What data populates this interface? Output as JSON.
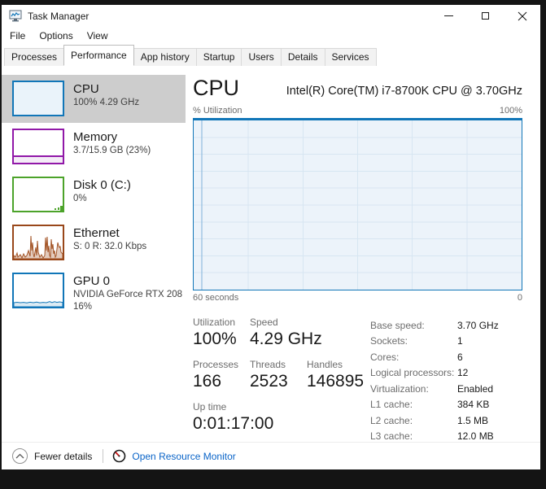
{
  "window": {
    "title": "Task Manager"
  },
  "menu": {
    "items": [
      "File",
      "Options",
      "View"
    ]
  },
  "tabs": {
    "items": [
      "Processes",
      "Performance",
      "App history",
      "Startup",
      "Users",
      "Details",
      "Services"
    ],
    "active": "Performance"
  },
  "sidebar": {
    "items": [
      {
        "label": "CPU",
        "line2": "100% 4.29 GHz"
      },
      {
        "label": "Memory",
        "line2": "3.7/15.9 GB (23%)"
      },
      {
        "label": "Disk 0 (C:)",
        "line2": "0%"
      },
      {
        "label": "Ethernet",
        "line2": "S: 0 R: 32.0 Kbps"
      },
      {
        "label": "GPU 0",
        "line2": "NVIDIA GeForce RTX 208",
        "line3": "16%"
      }
    ]
  },
  "main": {
    "title": "CPU",
    "subtitle": "Intel(R) Core(TM) i7-8700K CPU @ 3.70GHz",
    "chart": {
      "y_axis_label": "% Utilization",
      "y_max_label": "100%",
      "x_left_label": "60 seconds",
      "x_right_label": "0"
    },
    "stats": {
      "utilization": {
        "label": "Utilization",
        "value": "100%"
      },
      "speed": {
        "label": "Speed",
        "value": "4.29 GHz"
      },
      "processes": {
        "label": "Processes",
        "value": "166"
      },
      "threads": {
        "label": "Threads",
        "value": "2523"
      },
      "handles": {
        "label": "Handles",
        "value": "146895"
      },
      "uptime": {
        "label": "Up time",
        "value": "0:01:17:00"
      }
    },
    "details": [
      {
        "label": "Base speed:",
        "value": "3.70 GHz"
      },
      {
        "label": "Sockets:",
        "value": "1"
      },
      {
        "label": "Cores:",
        "value": "6"
      },
      {
        "label": "Logical processors:",
        "value": "12"
      },
      {
        "label": "Virtualization:",
        "value": "Enabled"
      },
      {
        "label": "L1 cache:",
        "value": "384 KB"
      },
      {
        "label": "L2 cache:",
        "value": "1.5 MB"
      },
      {
        "label": "L3 cache:",
        "value": "12.0 MB"
      }
    ]
  },
  "footer": {
    "fewer_details": "Fewer details",
    "open_resource_monitor": "Open Resource Monitor"
  },
  "colors": {
    "accent_blue": "#1176b8",
    "memory_purple": "#9118a8",
    "disk_green": "#4ca32a",
    "ethernet_brown": "#99471a",
    "link_blue": "#0a64c8",
    "selected_gray": "#cdcdcd"
  }
}
